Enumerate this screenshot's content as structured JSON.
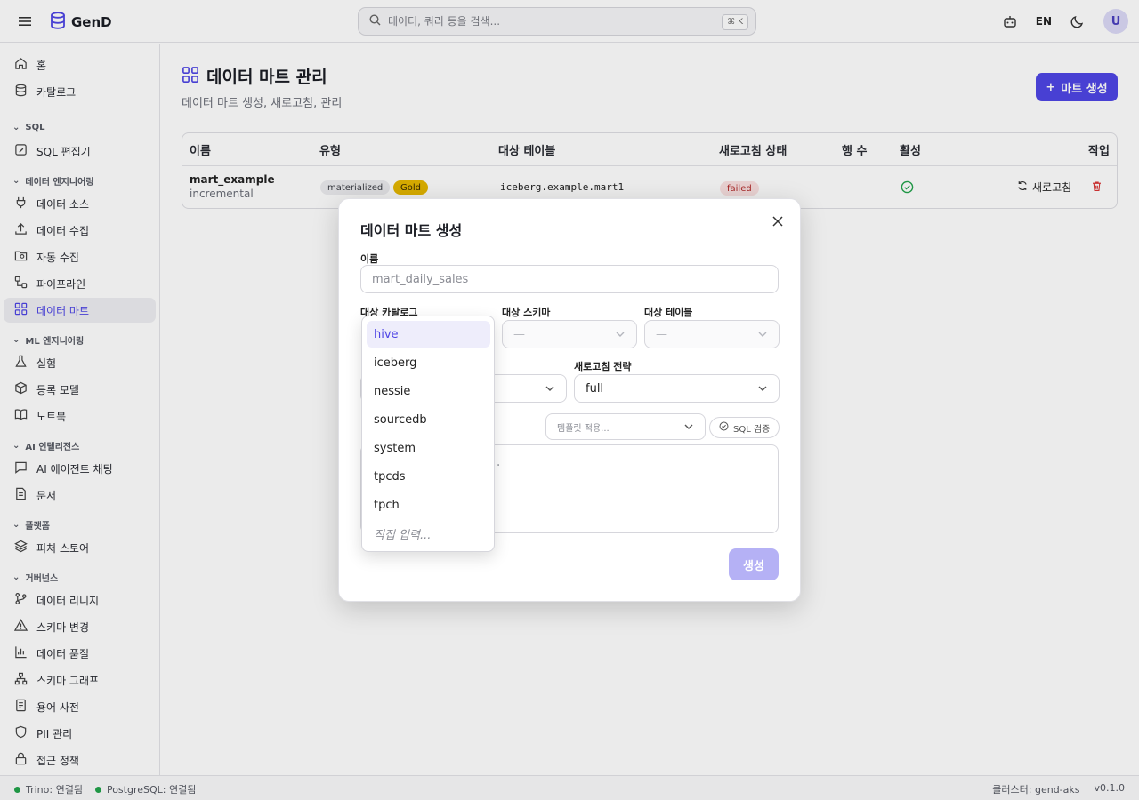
{
  "app": {
    "name": "GenD"
  },
  "search": {
    "placeholder": "데이터, 쿼리 등을 검색...",
    "shortcut": "⌘ K"
  },
  "header": {
    "lang": "EN",
    "avatar_initial": "U"
  },
  "sidebar": {
    "items_top": [
      {
        "label": "홈",
        "icon": "home-icon"
      },
      {
        "label": "카탈로그",
        "icon": "database-icon"
      }
    ],
    "sections": [
      {
        "title": "SQL",
        "items": [
          {
            "label": "SQL 편집기",
            "icon": "edit-icon"
          }
        ]
      },
      {
        "title": "데이터 엔지니어링",
        "items": [
          {
            "label": "데이터 소스",
            "icon": "plug-icon"
          },
          {
            "label": "데이터 수집",
            "icon": "upload-icon"
          },
          {
            "label": "자동 수집",
            "icon": "folder-search-icon"
          },
          {
            "label": "파이프라인",
            "icon": "workflow-icon"
          },
          {
            "label": "데이터 마트",
            "icon": "grid-icon",
            "active": true
          }
        ]
      },
      {
        "title": "ML 엔지니어링",
        "items": [
          {
            "label": "실험",
            "icon": "flask-icon"
          },
          {
            "label": "등록 모델",
            "icon": "box-icon"
          },
          {
            "label": "노트북",
            "icon": "book-icon"
          }
        ]
      },
      {
        "title": "AI 인텔리전스",
        "items": [
          {
            "label": "AI 에이전트 채팅",
            "icon": "chat-icon"
          },
          {
            "label": "문서",
            "icon": "document-icon"
          }
        ]
      },
      {
        "title": "플랫폼",
        "items": [
          {
            "label": "피처 스토어",
            "icon": "layers-icon"
          }
        ]
      },
      {
        "title": "거버넌스",
        "items": [
          {
            "label": "데이터 리니지",
            "icon": "git-branch-icon"
          },
          {
            "label": "스키마 변경",
            "icon": "warning-icon"
          },
          {
            "label": "데이터 품질",
            "icon": "bar-chart-icon"
          },
          {
            "label": "스키마 그래프",
            "icon": "network-icon"
          },
          {
            "label": "용어 사전",
            "icon": "notebook-icon"
          },
          {
            "label": "PII 관리",
            "icon": "shield-icon"
          },
          {
            "label": "접근 정책",
            "icon": "lock-icon"
          }
        ]
      }
    ]
  },
  "page": {
    "title": "데이터 마트 관리",
    "subtitle": "데이터 마트 생성, 새로고침, 관리",
    "create_button": "마트 생성"
  },
  "table": {
    "headers": [
      "이름",
      "유형",
      "대상 테이블",
      "새로고침 상태",
      "행 수",
      "활성",
      "작업"
    ],
    "rows": [
      {
        "name": "mart_example",
        "mode": "incremental",
        "type": "materialized",
        "tier": "Gold",
        "target": "iceberg.example.mart1",
        "status": "failed",
        "row_count": "-",
        "active": true,
        "refresh_label": "새로고침"
      }
    ]
  },
  "modal": {
    "title": "데이터 마트 생성",
    "name_label": "이름",
    "name_placeholder": "mart_daily_sales",
    "catalog_label": "대상 카탈로그",
    "schema_label": "대상 스키마",
    "schema_value": "—",
    "table_label": "대상 테이블",
    "table_value": "—",
    "refresh_label": "새로고침 전략",
    "refresh_value": "full",
    "template_placeholder": "템플릿 적용...",
    "validate_label": "SQL 검증",
    "sql_placeholder": "...",
    "submit_label": "생성"
  },
  "catalog_dropdown": {
    "options": [
      "hive",
      "iceberg",
      "nessie",
      "sourcedb",
      "system",
      "tpcds",
      "tpch"
    ],
    "selected": "hive",
    "custom_label": "직접 입력..."
  },
  "status": {
    "trino": "Trino: 연결됨",
    "postgres": "PostgreSQL: 연결됨",
    "cluster": "클러스터: gend-aks",
    "version": "v0.1.0"
  },
  "colors": {
    "accent": "#4f46e5",
    "success": "#22a34b",
    "danger": "#d93636",
    "gold": "#e6b800"
  }
}
